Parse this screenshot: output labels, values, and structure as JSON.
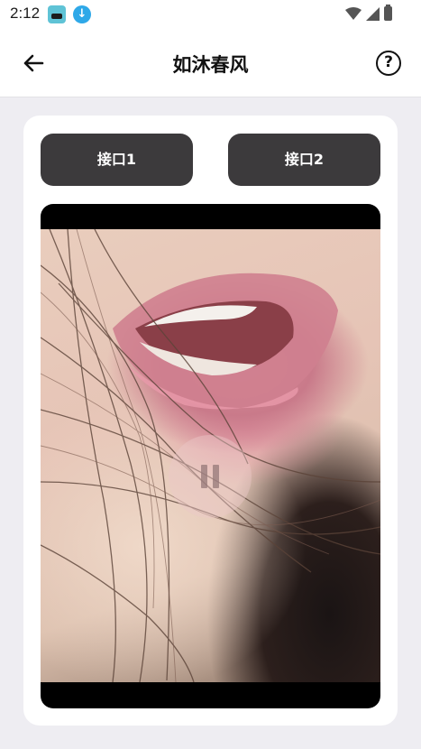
{
  "status_bar": {
    "time": "2:12",
    "icons": [
      "app-icon",
      "download-icon",
      "wifi-icon",
      "signal-icon",
      "battery-icon"
    ]
  },
  "header": {
    "title": "如沐春风",
    "back_icon": "arrow-left-icon",
    "help_icon": "question-circle-icon"
  },
  "content": {
    "buttons": [
      {
        "label": "接口1"
      },
      {
        "label": "接口2"
      }
    ],
    "video": {
      "state": "paused",
      "overlay_icon": "pause-icon"
    }
  },
  "colors": {
    "background": "#eeedf2",
    "button": "#3c3a3c",
    "button_text": "#ffffff",
    "card": "#ffffff"
  }
}
